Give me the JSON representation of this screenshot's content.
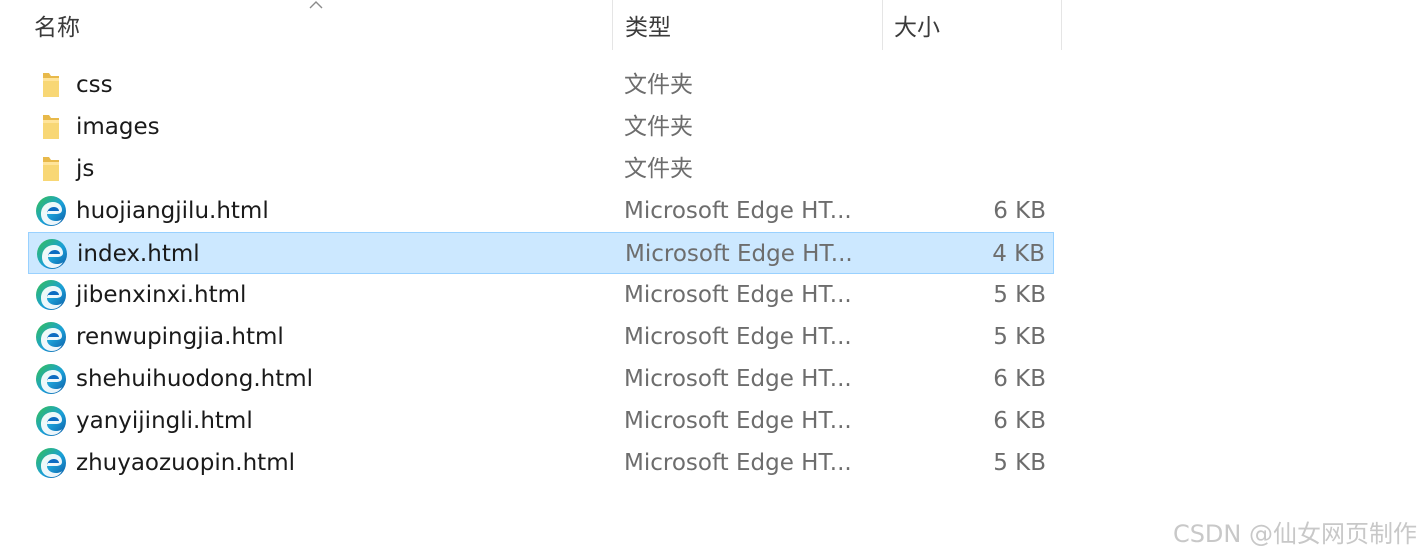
{
  "header": {
    "name_label": "名称",
    "type_label": "类型",
    "size_label": "大小"
  },
  "rows": [
    {
      "name": "css",
      "type": "文件夹",
      "size": "",
      "icon": "folder-icon"
    },
    {
      "name": "images",
      "type": "文件夹",
      "size": "",
      "icon": "folder-icon"
    },
    {
      "name": "js",
      "type": "文件夹",
      "size": "",
      "icon": "folder-icon"
    },
    {
      "name": "huojiangjilu.html",
      "type": "Microsoft Edge HT...",
      "size": "6 KB",
      "icon": "edge-html-icon"
    },
    {
      "name": "index.html",
      "type": "Microsoft Edge HT...",
      "size": "4 KB",
      "icon": "edge-html-icon",
      "selected": true
    },
    {
      "name": "jibenxinxi.html",
      "type": "Microsoft Edge HT...",
      "size": "5 KB",
      "icon": "edge-html-icon"
    },
    {
      "name": "renwupingjia.html",
      "type": "Microsoft Edge HT...",
      "size": "5 KB",
      "icon": "edge-html-icon"
    },
    {
      "name": "shehuihuodong.html",
      "type": "Microsoft Edge HT...",
      "size": "6 KB",
      "icon": "edge-html-icon"
    },
    {
      "name": "yanyijingli.html",
      "type": "Microsoft Edge HT...",
      "size": "6 KB",
      "icon": "edge-html-icon"
    },
    {
      "name": "zhuyaozuopin.html",
      "type": "Microsoft Edge HT...",
      "size": "5 KB",
      "icon": "edge-html-icon"
    }
  ],
  "watermark": "CSDN @仙女网页制作",
  "colors": {
    "selection_bg": "#cce8ff",
    "selection_border": "#99d1ff",
    "folder": "#f8d775",
    "edge_blue": "#0c6cc2",
    "edge_green": "#35c14f"
  }
}
